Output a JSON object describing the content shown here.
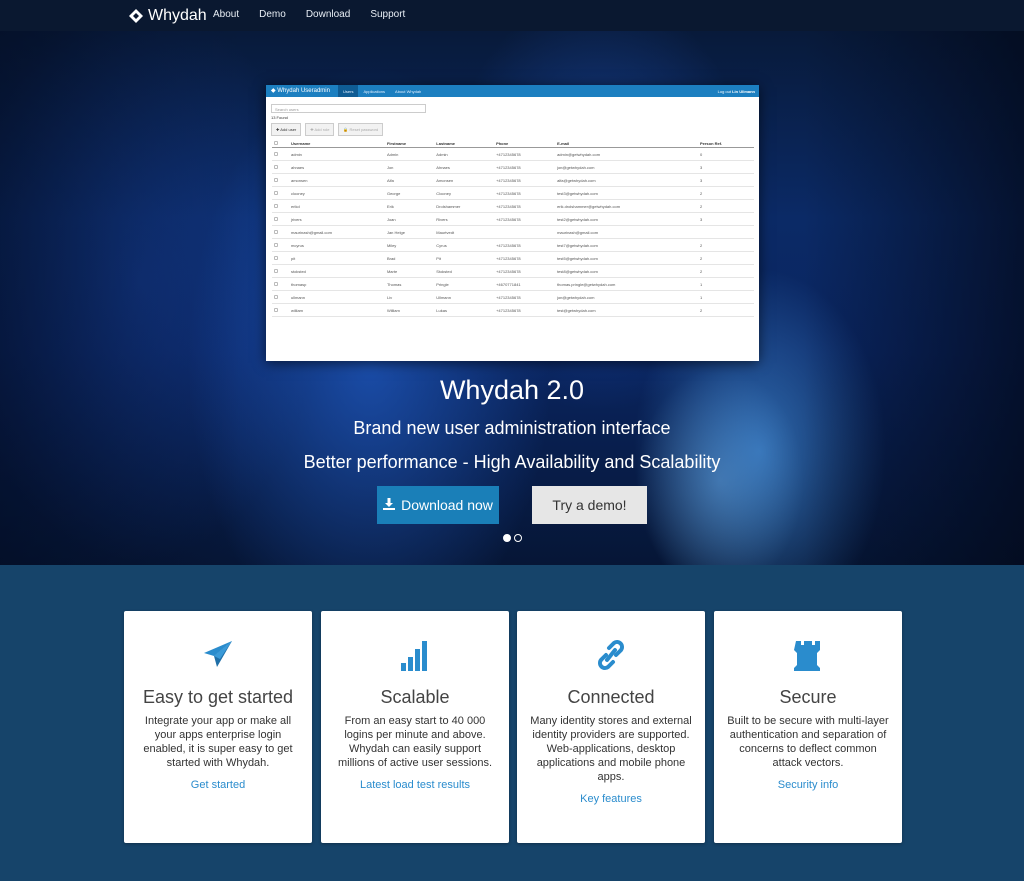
{
  "nav": {
    "brand": "Whydah",
    "links": [
      "About",
      "Demo",
      "Download",
      "Support"
    ]
  },
  "app": {
    "brand": "Whydah Useradmin",
    "tabs": [
      "Users",
      "Applications",
      "About Whydah"
    ],
    "logout_prefix": "Log out",
    "logout_user": "Lin Ullmann",
    "search_placeholder": "Search users",
    "count": "13 Found",
    "buttons": [
      "Add user",
      "Add role",
      "Reset password"
    ],
    "columns": [
      "Username",
      "Firstname",
      "Lastname",
      "Phone",
      "E-mail",
      "Person Ref."
    ],
    "rows": [
      [
        "admin",
        "Admin",
        "Admin",
        "+4712345678",
        "admin@getwhydah.com",
        "0"
      ],
      [
        "ahnaes",
        "Jon",
        "Ahnaes",
        "+4712345678",
        "jon@getwhydah.com",
        "3"
      ],
      [
        "amonsen",
        "Alfa",
        "Amonsen",
        "+4712345678",
        "alfa@getwhydah.com",
        "3"
      ],
      [
        "clooney",
        "George",
        "Clooney",
        "+4712345678",
        "test3@getwhydah.com",
        "2"
      ],
      [
        "erikd",
        "Erik",
        "Drolshammer",
        "+4712345678",
        "erik.drolshammer@getwhydah.com",
        "2"
      ],
      [
        "jrivers",
        "Joan",
        "Rivers",
        "+4712345678",
        "test2@getwhydah.com",
        "3"
      ],
      [
        "maurinash@gmail.com",
        "Jan Helge",
        "Maurtvedt",
        "",
        "maurinash@gmail.com",
        ""
      ],
      [
        "mcyrus",
        "Miley",
        "Cyrus",
        "+4712345678",
        "test7@getwhydah.com",
        "2"
      ],
      [
        "pit",
        "Brad",
        "Pit",
        "+4712345678",
        "test5@getwhydah.com",
        "2"
      ],
      [
        "stoksted",
        "Marte",
        "Stoksted",
        "+4712345678",
        "test8@getwhydah.com",
        "2"
      ],
      [
        "thomasp",
        "Thomas",
        "Pringle",
        "+4670771841",
        "thomas.pringle@getwhydah.com",
        "1"
      ],
      [
        "ullmann",
        "Liv",
        "Ullmann",
        "+4712345678",
        "jon@getwhydah.com",
        "1"
      ],
      [
        "william",
        "William",
        "Lukas",
        "+4712345678",
        "test@getwhydah.com",
        "2"
      ]
    ]
  },
  "hero": {
    "title": "Whydah 2.0",
    "subtitle1": "Brand new user administration interface",
    "subtitle2": "Better performance - High Availability and Scalability",
    "download_label": "Download now",
    "demo_label": "Try a demo!",
    "slides": 2,
    "active_slide": 1
  },
  "features": [
    {
      "icon": "paper-plane-icon",
      "title": "Easy to get started",
      "text": "Integrate your app or make all your apps enterprise login enabled, it is super easy to get started with Whydah.",
      "link": "Get started"
    },
    {
      "icon": "bar-chart-icon",
      "title": "Scalable",
      "text": "From an easy start to 40 000 logins per minute and above. Whydah can easily support millions of active user sessions.",
      "link": "Latest load test results"
    },
    {
      "icon": "chain-link-icon",
      "title": "Connected",
      "text": "Many identity stores and external identity providers are supported. Web-applications, desktop applications and mobile phone apps.",
      "link": "Key features"
    },
    {
      "icon": "castle-tower-icon",
      "title": "Secure",
      "text": "Built to be secure with multi-layer authentication and separation of concerns to deflect common attack vectors.",
      "link": "Security info"
    }
  ],
  "colors": {
    "accent": "#2a8ccd",
    "download_button": "#1a7fb8",
    "features_bg": "#16446a",
    "navbar_bg": "#0a1830"
  }
}
